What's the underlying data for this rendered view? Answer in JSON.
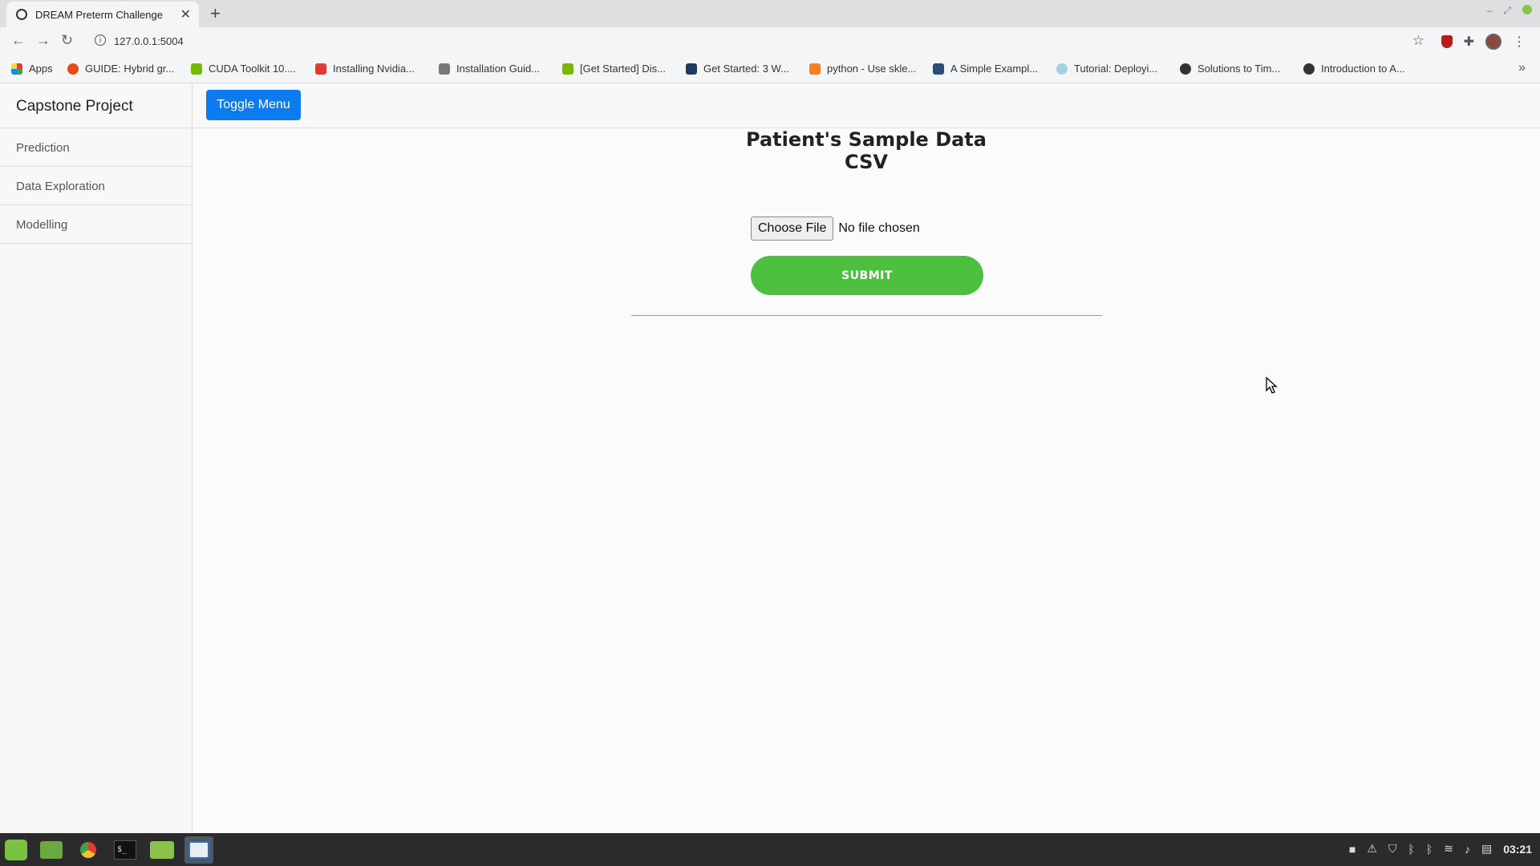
{
  "browser": {
    "tab_title": "DREAM Preterm Challenge",
    "url": "127.0.0.1:5004",
    "bookmarks": [
      {
        "label": "Apps",
        "color": "#e53935"
      },
      {
        "label": "GUIDE: Hybrid gr...",
        "color": "#e64a19"
      },
      {
        "label": "CUDA Toolkit 10....",
        "color": "#76b900"
      },
      {
        "label": "Installing Nvidia...",
        "color": "#e53935"
      },
      {
        "label": "Installation Guid...",
        "color": "#555555"
      },
      {
        "label": "[Get Started] Dis...",
        "color": "#76b900"
      },
      {
        "label": "Get Started: 3 W...",
        "color": "#1e3a5f"
      },
      {
        "label": "python - Use skle...",
        "color": "#f48024"
      },
      {
        "label": "A Simple Exampl...",
        "color": "#2c4a7a"
      },
      {
        "label": "Tutorial: Deployi...",
        "color": "#9fd3e0"
      },
      {
        "label": "Solutions to Tim...",
        "color": "#333333"
      },
      {
        "label": "Introduction to A...",
        "color": "#333333"
      }
    ]
  },
  "app": {
    "brand": "Capstone Project",
    "sidebar_items": [
      "Prediction",
      "Data Exploration",
      "Modelling"
    ],
    "toggle_label": "Toggle Menu",
    "heading_line1": "Patient's Sample Data",
    "heading_line2": "CSV",
    "choose_file_label": "Choose File",
    "file_status": "No file chosen",
    "submit_label": "SUBMIT",
    "colors": {
      "primary": "#0d7bf0",
      "submit": "#4cbf3f"
    }
  },
  "taskbar": {
    "clock": "03:21",
    "apps": [
      "mint-menu-icon",
      "files-icon",
      "chrome-icon",
      "terminal-icon",
      "folder-icon",
      "screenshot-icon"
    ]
  }
}
